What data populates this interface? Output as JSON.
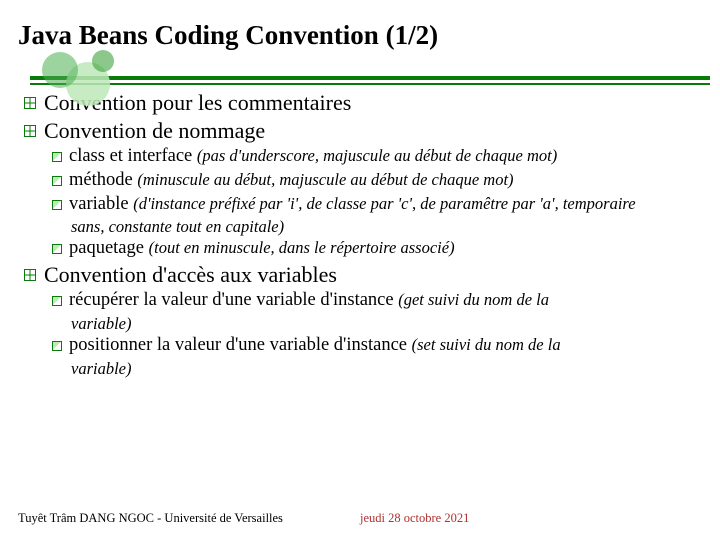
{
  "title": "Java Beans Coding Convention (1/2)",
  "items": [
    {
      "text": "Convention pour les commentaires"
    },
    {
      "text": "Convention de nommage"
    },
    {
      "text": "class et interface",
      "note": "(pas d'underscore, majuscule au début de chaque mot)",
      "sub": true
    },
    {
      "text": "méthode",
      "note": "(minuscule au début, majuscule au début de chaque mot)",
      "sub": true
    },
    {
      "text": "variable",
      "note": "(d'instance préfixé par 'i', de classe par 'c', de paramêtre par 'a', temporaire",
      "cont": "sans, constante tout en capitale)",
      "sub": true
    },
    {
      "text": "paquetage",
      "note": "(tout en minuscule, dans le répertoire associé)",
      "sub": true
    },
    {
      "text": "Convention d'accès aux variables"
    },
    {
      "text": "récupérer la valeur d'une variable d'instance",
      "note": "(get suivi du nom de la",
      "cont": "variable)",
      "sub": true
    },
    {
      "text": "positionner la valeur d'une variable d'instance",
      "note": "(set suivi du nom de la",
      "cont": "variable)",
      "sub": true
    }
  ],
  "footer": {
    "left": "Tuyêt Trâm DANG NGOC - Université de Versailles",
    "right": "jeudi 28 octobre 2021"
  }
}
